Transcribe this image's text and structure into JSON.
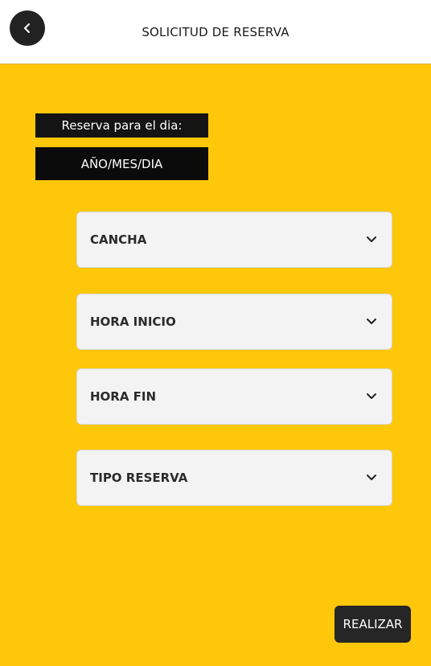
{
  "header": {
    "title": "SOLICITUD DE RESERVA",
    "back_icon": "chevron-left-icon"
  },
  "date": {
    "label": "Reserva para el dia:",
    "value": "AÑO/MES/DIA"
  },
  "selects": [
    {
      "label": "CANCHA",
      "icon": "chevron-down-icon"
    },
    {
      "label": "HORA INICIO",
      "icon": "chevron-down-icon"
    },
    {
      "label": "HORA FIN",
      "icon": "chevron-down-icon"
    },
    {
      "label": "TIPO RESERVA",
      "icon": "chevron-down-icon"
    }
  ],
  "submit": {
    "label": "REALIZAR"
  },
  "colors": {
    "background": "#ffc709",
    "header": "#ffffff",
    "dark": "#141414",
    "select_bg": "#f3f3f3"
  }
}
